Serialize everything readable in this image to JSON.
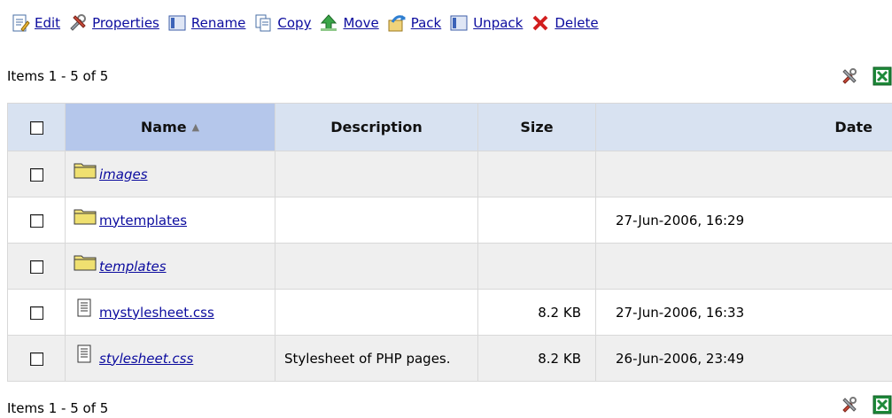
{
  "toolbar": {
    "items": [
      {
        "label": "Edit",
        "icon": "edit-icon"
      },
      {
        "label": "Properties",
        "icon": "properties-icon"
      },
      {
        "label": "Rename",
        "icon": "rename-icon"
      },
      {
        "label": "Copy",
        "icon": "copy-icon"
      },
      {
        "label": "Move",
        "icon": "move-icon"
      },
      {
        "label": "Pack",
        "icon": "pack-icon"
      },
      {
        "label": "Unpack",
        "icon": "unpack-icon"
      },
      {
        "label": "Delete",
        "icon": "delete-icon"
      }
    ]
  },
  "pager": {
    "top_text": "Items 1 - 5 of 5",
    "bottom_text": "Items 1 - 5 of 5"
  },
  "side_icons": [
    "tools-icon",
    "excel-export-icon"
  ],
  "table": {
    "headers": {
      "name": "Name",
      "description": "Description",
      "size": "Size",
      "date": "Date"
    },
    "sort_indicator": "▲",
    "rows": [
      {
        "type": "folder",
        "name": "images",
        "description": "",
        "size": "",
        "date": ""
      },
      {
        "type": "folder",
        "name": "mytemplates",
        "description": "",
        "size": "",
        "date": "27-Jun-2006, 16:29"
      },
      {
        "type": "folder",
        "name": "templates",
        "description": "",
        "size": "",
        "date": ""
      },
      {
        "type": "file",
        "name": "mystylesheet.css",
        "description": "",
        "size": "8.2 KB",
        "date": "27-Jun-2006, 16:33"
      },
      {
        "type": "file",
        "name": "stylesheet.css",
        "description": "Stylesheet of PHP pages.",
        "size": "8.2 KB",
        "date": "26-Jun-2006, 23:49"
      }
    ]
  },
  "colors": {
    "link": "#0b0b9e",
    "header_bg": "#d8e2f1",
    "sorted_header_bg": "#b5c7eb",
    "alt_row_bg": "#efefef"
  }
}
